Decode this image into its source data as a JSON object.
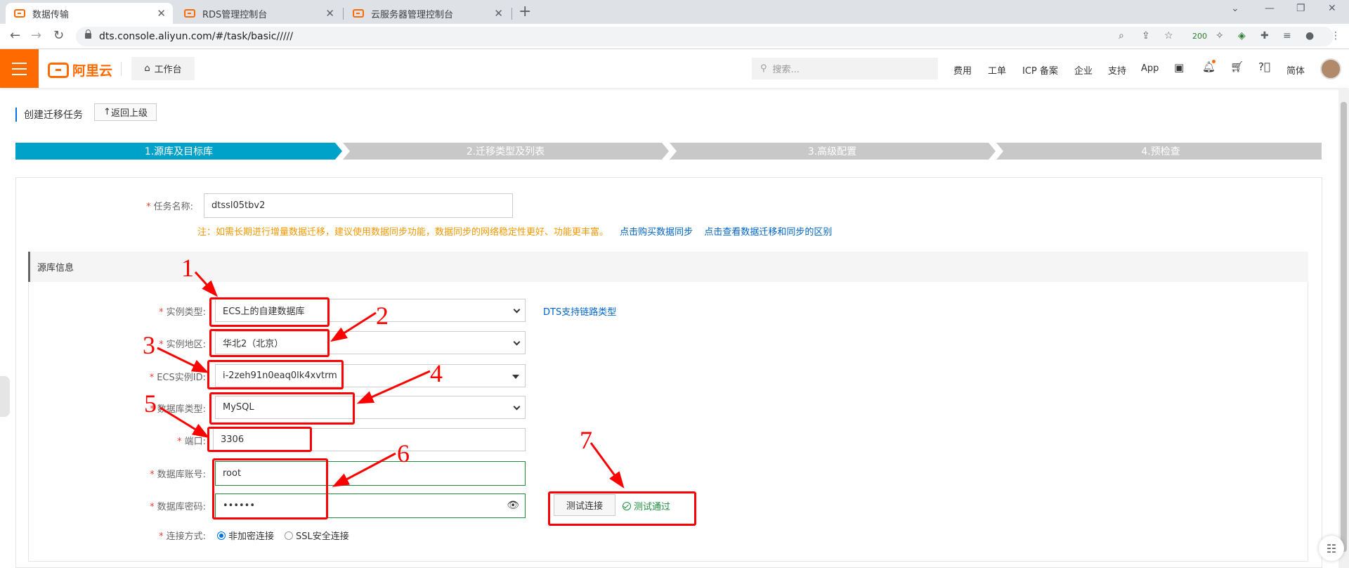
{
  "browser": {
    "tabs": [
      {
        "label": "数据传输"
      },
      {
        "label": "RDS管理控制台"
      },
      {
        "label": "云服务器管理控制台"
      }
    ],
    "url": "dts.console.aliyun.com/#/task/basic/////",
    "ext_badge": "200"
  },
  "topbar": {
    "brand": "阿里云",
    "workbench": "工作台",
    "search_placeholder": "搜索...",
    "links": [
      "费用",
      "工单",
      "ICP 备案",
      "企业",
      "支持",
      "App"
    ],
    "lang": "简体"
  },
  "page": {
    "title": "创建迁移任务",
    "back_label": "返回上级",
    "steps": [
      "1.源库及目标库",
      "2.迁移类型及列表",
      "3.高级配置",
      "4.预检查"
    ]
  },
  "form": {
    "task_name_label": "任务名称:",
    "task_name_value": "dtssl05tbv2",
    "note_text": "注：如需长期进行增量数据迁移，建议使用数据同步功能，数据同步的网络稳定性更好、功能更丰富。",
    "note_link1": "点击购买数据同步",
    "note_link2": "点击查看数据迁移和同步的区别",
    "section_title": "源库信息",
    "instance_type_label": "实例类型:",
    "instance_type_value": "ECS上的自建数据库",
    "dts_link": "DTS支持链路类型",
    "region_label": "实例地区:",
    "region_value": "华北2（北京）",
    "ecs_id_label": "ECS实例ID:",
    "ecs_id_value": "i-2zeh91n0eaq0lk4xvtrm",
    "db_type_label": "数据库类型:",
    "db_type_value": "MySQL",
    "port_label": "端口:",
    "port_value": "3306",
    "account_label": "数据库账号:",
    "account_value": "root",
    "password_label": "数据库密码:",
    "password_value": "••••••",
    "conn_label": "连接方式:",
    "conn_options": [
      "非加密连接",
      "SSL安全连接"
    ],
    "test_button": "测试连接",
    "test_result": "测试通过"
  },
  "annotations": [
    "1",
    "2",
    "3",
    "4",
    "5",
    "6",
    "7"
  ],
  "colors": {
    "accent": "#ff6a00",
    "step_active": "#00a2ca",
    "step_inactive": "#c8c8c8",
    "annotation": "#ff0000",
    "success": "#1e8e3e"
  }
}
